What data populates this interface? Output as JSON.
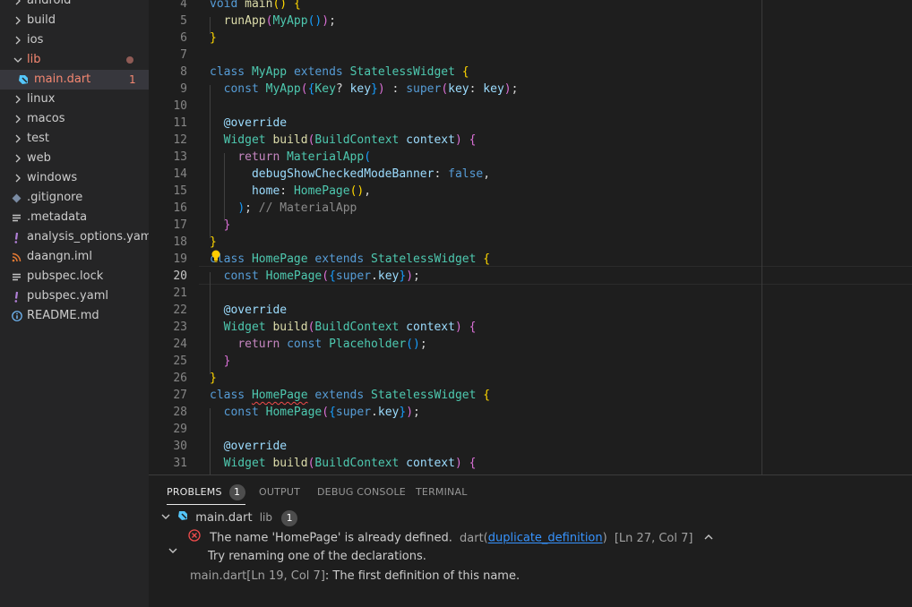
{
  "explorer": {
    "items": [
      {
        "label": "android",
        "icon": "chevron-right-icon"
      },
      {
        "label": "build",
        "icon": "chevron-right-icon"
      },
      {
        "label": "ios",
        "icon": "chevron-right-icon"
      },
      {
        "label": "lib",
        "icon": "chevron-down-icon"
      },
      {
        "label": "main.dart",
        "icon": "dart-icon",
        "problems": "1"
      },
      {
        "label": "linux",
        "icon": "chevron-right-icon"
      },
      {
        "label": "macos",
        "icon": "chevron-right-icon"
      },
      {
        "label": "test",
        "icon": "chevron-right-icon"
      },
      {
        "label": "web",
        "icon": "chevron-right-icon"
      },
      {
        "label": "windows",
        "icon": "chevron-right-icon"
      },
      {
        "label": ".gitignore",
        "icon": "git-icon"
      },
      {
        "label": ".metadata",
        "icon": "lines-icon"
      },
      {
        "label": "analysis_options.yaml",
        "icon": "exclamation-icon"
      },
      {
        "label": "daangn.iml",
        "icon": "rss-icon"
      },
      {
        "label": "pubspec.lock",
        "icon": "lines-icon"
      },
      {
        "label": "pubspec.yaml",
        "icon": "exclamation-icon"
      },
      {
        "label": "README.md",
        "icon": "info-icon"
      }
    ]
  },
  "editor": {
    "current_line": 20,
    "lines": [
      {
        "n": "4",
        "tokens": [
          [
            "kw",
            "void"
          ],
          [
            "pl",
            " "
          ],
          [
            "fn",
            "main"
          ],
          [
            "b1",
            "()"
          ],
          [
            "pl",
            " "
          ],
          [
            "b1",
            "{"
          ]
        ]
      },
      {
        "n": "5",
        "tokens": [
          [
            "pl",
            "  "
          ],
          [
            "fn",
            "runApp"
          ],
          [
            "b2",
            "("
          ],
          [
            "ty",
            "MyApp"
          ],
          [
            "b3",
            "()"
          ],
          [
            "b2",
            ")"
          ],
          [
            "pl",
            ";"
          ]
        ]
      },
      {
        "n": "6",
        "tokens": [
          [
            "b1",
            "}"
          ]
        ]
      },
      {
        "n": "7",
        "tokens": []
      },
      {
        "n": "8",
        "tokens": [
          [
            "kw",
            "class"
          ],
          [
            "pl",
            " "
          ],
          [
            "ty",
            "MyApp"
          ],
          [
            "pl",
            " "
          ],
          [
            "kw",
            "extends"
          ],
          [
            "pl",
            " "
          ],
          [
            "ty",
            "StatelessWidget"
          ],
          [
            "pl",
            " "
          ],
          [
            "b1",
            "{"
          ]
        ]
      },
      {
        "n": "9",
        "tokens": [
          [
            "pl",
            "  "
          ],
          [
            "kw",
            "const"
          ],
          [
            "pl",
            " "
          ],
          [
            "ty",
            "MyApp"
          ],
          [
            "b2",
            "("
          ],
          [
            "b3",
            "{"
          ],
          [
            "ty",
            "Key"
          ],
          [
            "pl",
            "? "
          ],
          [
            "va",
            "key"
          ],
          [
            "b3",
            "}"
          ],
          [
            "b2",
            ")"
          ],
          [
            "pl",
            " : "
          ],
          [
            "kw",
            "super"
          ],
          [
            "b2",
            "("
          ],
          [
            "va",
            "key"
          ],
          [
            "pl",
            ": "
          ],
          [
            "va",
            "key"
          ],
          [
            "b2",
            ")"
          ],
          [
            "pl",
            ";"
          ]
        ]
      },
      {
        "n": "10",
        "tokens": []
      },
      {
        "n": "11",
        "tokens": [
          [
            "pl",
            "  "
          ],
          [
            "va",
            "@override"
          ]
        ]
      },
      {
        "n": "12",
        "tokens": [
          [
            "pl",
            "  "
          ],
          [
            "ty",
            "Widget"
          ],
          [
            "pl",
            " "
          ],
          [
            "fn",
            "build"
          ],
          [
            "b2",
            "("
          ],
          [
            "ty",
            "BuildContext"
          ],
          [
            "pl",
            " "
          ],
          [
            "va",
            "context"
          ],
          [
            "b2",
            ")"
          ],
          [
            "pl",
            " "
          ],
          [
            "b2",
            "{"
          ]
        ]
      },
      {
        "n": "13",
        "tokens": [
          [
            "pl",
            "    "
          ],
          [
            "kw2",
            "return"
          ],
          [
            "pl",
            " "
          ],
          [
            "ty",
            "MaterialApp"
          ],
          [
            "b3",
            "("
          ]
        ]
      },
      {
        "n": "14",
        "tokens": [
          [
            "pl",
            "      "
          ],
          [
            "va",
            "debugShowCheckedModeBanner"
          ],
          [
            "pl",
            ": "
          ],
          [
            "kw",
            "false"
          ],
          [
            "pl",
            ","
          ]
        ]
      },
      {
        "n": "15",
        "tokens": [
          [
            "pl",
            "      "
          ],
          [
            "va",
            "home"
          ],
          [
            "pl",
            ": "
          ],
          [
            "ty",
            "HomePage"
          ],
          [
            "b1",
            "()"
          ],
          [
            "pl",
            ","
          ]
        ]
      },
      {
        "n": "16",
        "tokens": [
          [
            "pl",
            "    "
          ],
          [
            "b3",
            ")"
          ],
          [
            "pl",
            "; "
          ],
          [
            "cmg",
            "// MaterialApp"
          ]
        ]
      },
      {
        "n": "17",
        "tokens": [
          [
            "pl",
            "  "
          ],
          [
            "b2",
            "}"
          ]
        ]
      },
      {
        "n": "18",
        "tokens": [
          [
            "b1",
            "}"
          ]
        ]
      },
      {
        "n": "19",
        "tokens": [
          [
            "kw",
            "class"
          ],
          [
            "pl",
            " "
          ],
          [
            "ty",
            "HomePage"
          ],
          [
            "pl",
            " "
          ],
          [
            "kw",
            "extends"
          ],
          [
            "pl",
            " "
          ],
          [
            "ty",
            "StatelessWidget"
          ],
          [
            "pl",
            " "
          ],
          [
            "b1",
            "{"
          ]
        ]
      },
      {
        "n": "20",
        "tokens": [
          [
            "pl",
            "  "
          ],
          [
            "kw",
            "const"
          ],
          [
            "pl",
            " "
          ],
          [
            "ty",
            "HomePage"
          ],
          [
            "b2",
            "("
          ],
          [
            "b3",
            "{"
          ],
          [
            "kw",
            "super"
          ],
          [
            "pl",
            "."
          ],
          [
            "va",
            "key"
          ],
          [
            "b3",
            "}"
          ],
          [
            "b2",
            ")"
          ],
          [
            "pl",
            ";"
          ]
        ]
      },
      {
        "n": "21",
        "tokens": []
      },
      {
        "n": "22",
        "tokens": [
          [
            "pl",
            "  "
          ],
          [
            "va",
            "@override"
          ]
        ]
      },
      {
        "n": "23",
        "tokens": [
          [
            "pl",
            "  "
          ],
          [
            "ty",
            "Widget"
          ],
          [
            "pl",
            " "
          ],
          [
            "fn",
            "build"
          ],
          [
            "b2",
            "("
          ],
          [
            "ty",
            "BuildContext"
          ],
          [
            "pl",
            " "
          ],
          [
            "va",
            "context"
          ],
          [
            "b2",
            ")"
          ],
          [
            "pl",
            " "
          ],
          [
            "b2",
            "{"
          ]
        ]
      },
      {
        "n": "24",
        "tokens": [
          [
            "pl",
            "    "
          ],
          [
            "kw2",
            "return"
          ],
          [
            "pl",
            " "
          ],
          [
            "kw",
            "const"
          ],
          [
            "pl",
            " "
          ],
          [
            "ty",
            "Placeholder"
          ],
          [
            "b3",
            "()"
          ],
          [
            "pl",
            ";"
          ]
        ]
      },
      {
        "n": "25",
        "tokens": [
          [
            "pl",
            "  "
          ],
          [
            "b2",
            "}"
          ]
        ]
      },
      {
        "n": "26",
        "tokens": [
          [
            "b1",
            "}"
          ]
        ]
      },
      {
        "n": "27",
        "tokens": [
          [
            "kw",
            "class"
          ],
          [
            "pl",
            " "
          ],
          [
            "ty squig",
            "HomePage"
          ],
          [
            "pl",
            " "
          ],
          [
            "kw",
            "extends"
          ],
          [
            "pl",
            " "
          ],
          [
            "ty",
            "StatelessWidget"
          ],
          [
            "pl",
            " "
          ],
          [
            "b1",
            "{"
          ]
        ]
      },
      {
        "n": "28",
        "tokens": [
          [
            "pl",
            "  "
          ],
          [
            "kw",
            "const"
          ],
          [
            "pl",
            " "
          ],
          [
            "ty",
            "HomePage"
          ],
          [
            "b2",
            "("
          ],
          [
            "b3",
            "{"
          ],
          [
            "kw",
            "super"
          ],
          [
            "pl",
            "."
          ],
          [
            "va",
            "key"
          ],
          [
            "b3",
            "}"
          ],
          [
            "b2",
            ")"
          ],
          [
            "pl",
            ";"
          ]
        ]
      },
      {
        "n": "29",
        "tokens": []
      },
      {
        "n": "30",
        "tokens": [
          [
            "pl",
            "  "
          ],
          [
            "va",
            "@override"
          ]
        ]
      },
      {
        "n": "31",
        "tokens": [
          [
            "pl",
            "  "
          ],
          [
            "ty",
            "Widget"
          ],
          [
            "pl",
            " "
          ],
          [
            "fn",
            "build"
          ],
          [
            "b2",
            "("
          ],
          [
            "ty",
            "BuildContext"
          ],
          [
            "pl",
            " "
          ],
          [
            "va",
            "context"
          ],
          [
            "b2",
            ")"
          ],
          [
            "pl",
            " "
          ],
          [
            "b2",
            "{"
          ]
        ]
      }
    ]
  },
  "panel": {
    "tabs": [
      {
        "label": "PROBLEMS",
        "badge": "1"
      },
      {
        "label": "OUTPUT"
      },
      {
        "label": "DEBUG CONSOLE"
      },
      {
        "label": "TERMINAL"
      }
    ],
    "file": {
      "name": "main.dart",
      "folder": "lib",
      "count": "1"
    },
    "error": {
      "message": "The name 'HomePage' is already defined.",
      "source": "dart",
      "code": "duplicate_definition",
      "location": "[Ln 27, Col 7]",
      "hint": "Try renaming one of the declarations.",
      "related_file": "main.dart",
      "related_location": "[Ln 19, Col 7]",
      "related_message": ": The first definition of this name."
    }
  },
  "colors": {
    "error": "#f14c4c",
    "accent": "#3794ff",
    "bulb": "#ffcc00"
  }
}
